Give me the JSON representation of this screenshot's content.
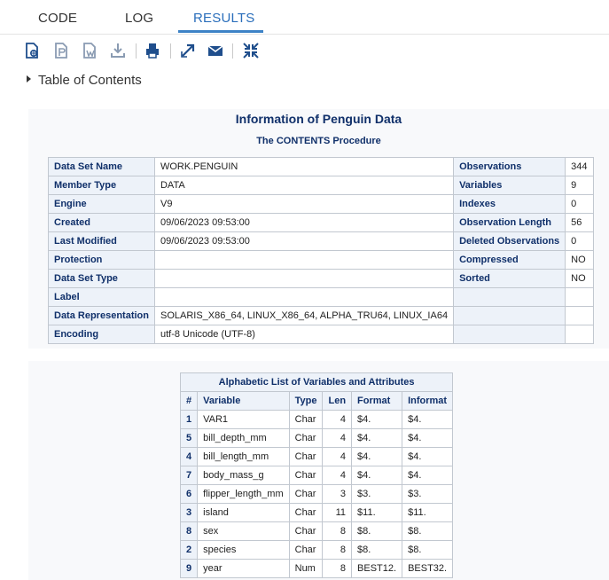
{
  "tabs": [
    "CODE",
    "LOG",
    "RESULTS"
  ],
  "toc_label": "Table of Contents",
  "procedure": {
    "title": "Information of Penguin Data",
    "subtitle": "The CONTENTS Procedure"
  },
  "info_rows": [
    [
      "Data Set Name",
      "WORK.PENGUIN",
      "Observations",
      "344"
    ],
    [
      "Member Type",
      "DATA",
      "Variables",
      "9"
    ],
    [
      "Engine",
      "V9",
      "Indexes",
      "0"
    ],
    [
      "Created",
      "09/06/2023 09:53:00",
      "Observation Length",
      "56"
    ],
    [
      "Last Modified",
      "09/06/2023 09:53:00",
      "Deleted Observations",
      "0"
    ],
    [
      "Protection",
      "",
      "Compressed",
      "NO"
    ],
    [
      "Data Set Type",
      "",
      "Sorted",
      "NO"
    ],
    [
      "Label",
      "",
      "",
      ""
    ],
    [
      "Data Representation",
      "SOLARIS_X86_64, LINUX_X86_64, ALPHA_TRU64, LINUX_IA64",
      "",
      ""
    ],
    [
      "Encoding",
      "utf-8 Unicode (UTF-8)",
      "",
      ""
    ]
  ],
  "var_table": {
    "caption": "Alphabetic List of Variables and Attributes",
    "columns": [
      "#",
      "Variable",
      "Type",
      "Len",
      "Format",
      "Informat"
    ],
    "rows": [
      [
        "1",
        "VAR1",
        "Char",
        "4",
        "$4.",
        "$4."
      ],
      [
        "5",
        "bill_depth_mm",
        "Char",
        "4",
        "$4.",
        "$4."
      ],
      [
        "4",
        "bill_length_mm",
        "Char",
        "4",
        "$4.",
        "$4."
      ],
      [
        "7",
        "body_mass_g",
        "Char",
        "4",
        "$4.",
        "$4."
      ],
      [
        "6",
        "flipper_length_mm",
        "Char",
        "3",
        "$3.",
        "$3."
      ],
      [
        "3",
        "island",
        "Char",
        "11",
        "$11.",
        "$11."
      ],
      [
        "8",
        "sex",
        "Char",
        "8",
        "$8.",
        "$8."
      ],
      [
        "2",
        "species",
        "Char",
        "8",
        "$8.",
        "$8."
      ],
      [
        "9",
        "year",
        "Num",
        "8",
        "BEST12.",
        "BEST32."
      ]
    ]
  },
  "toolbar_icons": [
    "html-doc-icon",
    "pdf-doc-icon",
    "rtf-doc-icon",
    "download-icon",
    "print-icon",
    "open-new-window-icon",
    "email-icon",
    "collapse-icon"
  ],
  "colors": {
    "accent": "#2a6ebb",
    "header_text": "#10306a",
    "header_bg": "#edf2f9",
    "icon": "#1f4e8c"
  }
}
